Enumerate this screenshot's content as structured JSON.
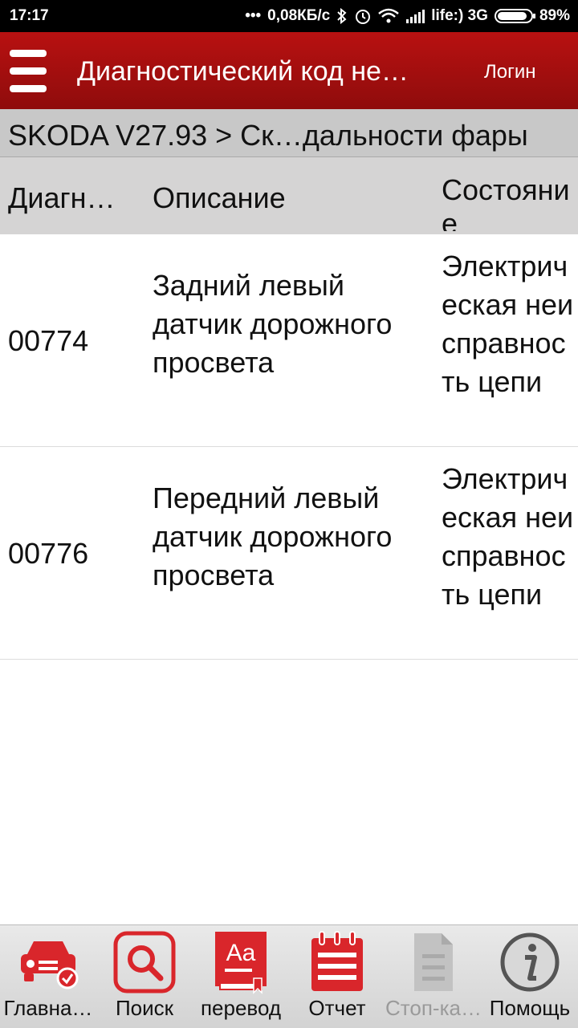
{
  "status_bar": {
    "time": "17:17",
    "network_speed": "0,08КБ/с",
    "carrier": "life:) 3G",
    "battery": "89%"
  },
  "app_bar": {
    "title": "Диагностический код не…",
    "login_label": "Логин",
    "accent_color": "#b01010"
  },
  "breadcrumb": "SKODA V27.93 > Ск…дальности фары",
  "table": {
    "headers": {
      "code": "Диагн…",
      "description": "Описание",
      "status": "Состояние"
    },
    "rows": [
      {
        "code": "00774",
        "description": "Задний левый датчик дорожного просвета",
        "status": "Электрическая неисправность цепи"
      },
      {
        "code": "00776",
        "description": "Передний левый датчик дорожного просвета",
        "status": "Электрическая неисправность цепи"
      }
    ]
  },
  "bottom_nav": [
    {
      "label": "Главна…",
      "icon": "car-check-icon",
      "enabled": true
    },
    {
      "label": "Поиск",
      "icon": "search-icon",
      "enabled": true
    },
    {
      "label": "перевод",
      "icon": "translate-icon",
      "enabled": true
    },
    {
      "label": "Отчет",
      "icon": "report-icon",
      "enabled": true
    },
    {
      "label": "Стоп-ка…",
      "icon": "document-icon",
      "enabled": false
    },
    {
      "label": "Помощь",
      "icon": "info-icon",
      "enabled": true
    }
  ]
}
